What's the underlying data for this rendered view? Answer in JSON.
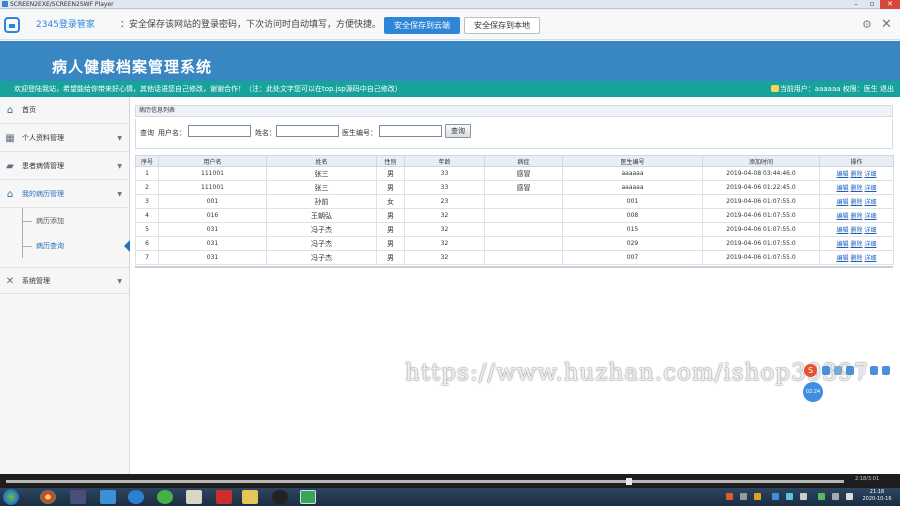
{
  "player": {
    "window_title": "SCREEN2EXE/SCREEN2SWF Player",
    "time": "2:18/3:01"
  },
  "pwbar": {
    "brand": "2345登录管家",
    "message": "：安全保存该网站的登录密码，下次访问时自动填写，方便快捷。",
    "btn_cloud": "安全保存到云端",
    "btn_local": "安全保存到本地"
  },
  "header": {
    "title": "病人健康档案管理系统"
  },
  "welcome": {
    "left": "欢迎登陆我站，希望能给你带来好心情，其他话语您自己修改，谢谢合作！（注：此处文字您可以在top.jsp源码中自己修改）",
    "right": "当前用户：aaaaaa  权限：医生  退出"
  },
  "sidebar": {
    "items": [
      {
        "label": "首页",
        "icon": "home-icon"
      },
      {
        "label": "个人资料管理",
        "icon": "grid-icon"
      },
      {
        "label": "患者病情管理",
        "icon": "folder-icon"
      },
      {
        "label": "我的病历管理",
        "icon": "home-icon"
      },
      {
        "label": "系统管理",
        "icon": "tools-icon"
      }
    ],
    "sub": [
      "病历添加",
      "病历查询"
    ]
  },
  "main": {
    "crumb": "病历信息列表",
    "search": {
      "prefix": "查询",
      "user_label": "用户名：",
      "name_label": "姓名：",
      "doctor_label": "医生编号：",
      "button": "查询"
    },
    "table": {
      "headers": [
        "序号",
        "用户名",
        "姓名",
        "性别",
        "年龄",
        "病症",
        "医生编号",
        "添加时间",
        "操作"
      ],
      "ops": [
        "编辑",
        "删除",
        "详细"
      ],
      "rows": [
        [
          "1",
          "111001",
          "张三",
          "男",
          "33",
          "感冒",
          "aaaaaa",
          "2019-04-08 03:44:46.0"
        ],
        [
          "2",
          "111001",
          "张三",
          "男",
          "33",
          "感冒",
          "aaaaaa",
          "2019-04-06 01:22:45.0"
        ],
        [
          "3",
          "001",
          "孙前",
          "女",
          "23",
          "",
          "001",
          "2019-04-06 01:07:55.0"
        ],
        [
          "4",
          "016",
          "王朝弘",
          "男",
          "32",
          "",
          "008",
          "2019-04-06 01:07:55.0"
        ],
        [
          "5",
          "031",
          "冯子杰",
          "男",
          "32",
          "",
          "015",
          "2019-04-06 01:07:55.0"
        ],
        [
          "6",
          "031",
          "冯子杰",
          "男",
          "32",
          "",
          "029",
          "2019-04-06 01:07:55.0"
        ],
        [
          "7",
          "031",
          "冯子杰",
          "男",
          "32",
          "",
          "007",
          "2019-04-06 01:07:55.0"
        ]
      ]
    }
  },
  "watermark": "https://www.huzhan.com/ishop39397",
  "timer": "02:24",
  "taskbar": {
    "time": "21:18",
    "date": "2020-10-16"
  },
  "colors": {
    "header": "#3886c2",
    "welcome": "#17a39c",
    "link": "#1f5fbf",
    "accent": "#2f86d8"
  }
}
